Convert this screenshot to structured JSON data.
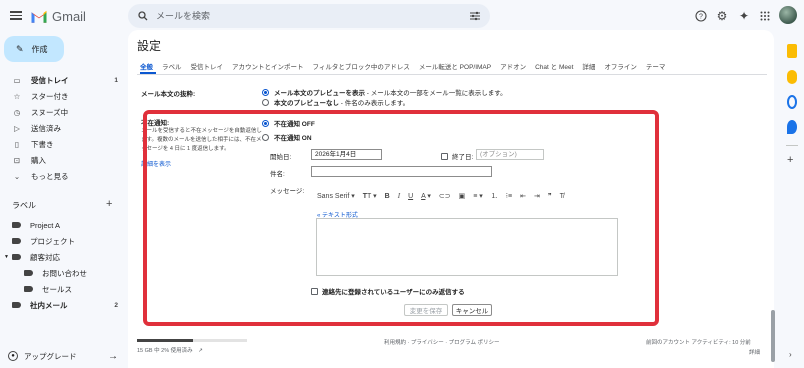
{
  "app": {
    "name": "Gmail"
  },
  "search": {
    "placeholder": "メールを検索"
  },
  "nav": {
    "compose": "作成",
    "items": [
      {
        "label": "受信トレイ",
        "count": "1",
        "icon": "inbox-icon"
      },
      {
        "label": "スター付き",
        "count": "",
        "icon": "star-icon"
      },
      {
        "label": "スヌーズ中",
        "count": "",
        "icon": "clock-icon"
      },
      {
        "label": "送信済み",
        "count": "",
        "icon": "send-icon"
      },
      {
        "label": "下書き",
        "count": "",
        "icon": "draft-icon"
      },
      {
        "label": "購入",
        "count": "",
        "icon": "cart-icon"
      },
      {
        "label": "もっと見る",
        "count": "",
        "icon": "chevron-down-icon"
      }
    ],
    "labels_title": "ラベル",
    "labels": [
      {
        "label": "Project A",
        "count": ""
      },
      {
        "label": "プロジェクト",
        "count": ""
      },
      {
        "label": "顧客対応",
        "count": ""
      },
      {
        "label": "お問い合わせ",
        "count": ""
      },
      {
        "label": "セールス",
        "count": ""
      },
      {
        "label": "社内メール",
        "count": "2"
      }
    ],
    "upgrade": "アップグレード"
  },
  "settings": {
    "title": "設定",
    "tabs": [
      "全般",
      "ラベル",
      "受信トレイ",
      "アカウントとインポート",
      "フィルタとブロック中のアドレス",
      "メール転送と POP/IMAP",
      "アドオン",
      "Chat と Meet",
      "詳細",
      "オフライン",
      "テーマ"
    ],
    "snippet": {
      "label": "メール本文の抜粋:",
      "option_on": "メール本文のプレビューを表示",
      "option_on_desc": " - メール本文の一部をメール一覧に表示します。",
      "option_off": "本文のプレビューなし",
      "option_off_desc": " - 件名のみ表示します。"
    },
    "vacation": {
      "label": "不在通知:",
      "desc": "メールを受信すると不在メッセージを自動返信します。複数のメールを送信した相手には、不在メッセージを 4 日に 1 度返信します。",
      "learn_more": "詳細を表示",
      "off": "不在通知 OFF",
      "on": "不在通知 ON",
      "start_label": "開始日:",
      "start_value": "2026年1月4日",
      "end_label": "終了日:",
      "end_placeholder": "(オプション)",
      "subject_label": "件名:",
      "message_label": "メッセージ:",
      "font": "Sans Serif",
      "plain_text": "« テキスト形式",
      "contacts_only": "連絡先に登録されているユーザーにのみ返信する",
      "save": "変更を保存",
      "cancel": "キャンセル"
    }
  },
  "footer": {
    "storage": "15 GB 中 2% 使用済み",
    "links": "利用規約 · プライバシー · プログラム ポリシー",
    "activity": "前回のアカウント アクティビティ: 10 分前",
    "details": "詳細"
  },
  "colors": {
    "highlight": "#e0303b",
    "accent": "#0b57d0",
    "compose_bg": "#c2e7ff"
  }
}
